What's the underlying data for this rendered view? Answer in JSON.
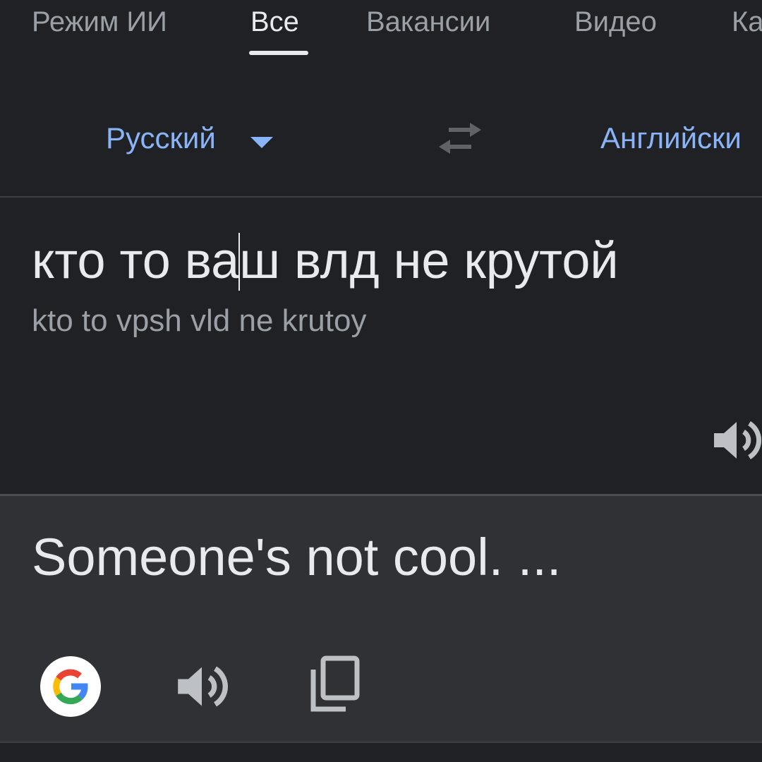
{
  "tabs": [
    {
      "label": "Режим ИИ",
      "active": false
    },
    {
      "label": "Все",
      "active": true
    },
    {
      "label": "Вакансии",
      "active": false
    },
    {
      "label": "Видео",
      "active": false
    },
    {
      "label": "Ка",
      "active": false
    }
  ],
  "translator": {
    "source_language": "Русский",
    "target_language": "Английски",
    "source_text_before_cursor": "кто то ва",
    "source_text_after_cursor": "ш влд не крутой",
    "transliteration": "kto to vpsh vld ne krutoy",
    "translation": "Someone's not cool. ..."
  },
  "icons": {
    "language_dropdown": "caret-down-icon",
    "swap": "swap-languages-icon",
    "source_listen": "speaker-icon",
    "google": "google-logo-icon",
    "translation_listen": "speaker-icon",
    "copy": "copy-icon"
  },
  "colors": {
    "background": "#202124",
    "result_background": "#303134",
    "accent": "#8ab4f8",
    "text": "#e8eaed",
    "muted_text": "#9aa0a6"
  }
}
